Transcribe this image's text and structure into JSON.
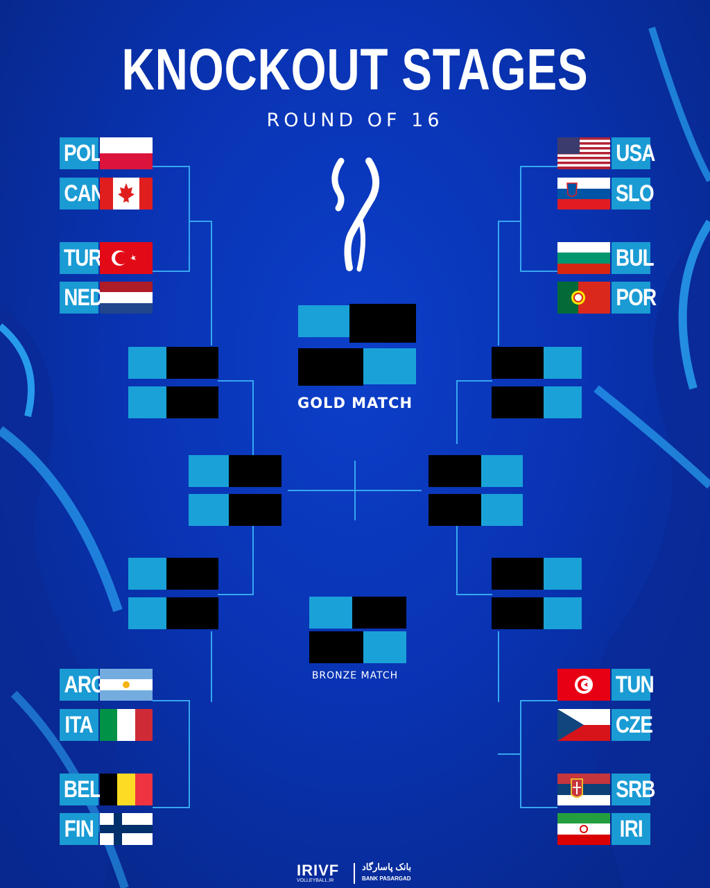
{
  "header": {
    "title": "KNOCKOUT STAGES",
    "subtitle": "ROUND OF 16"
  },
  "teams_left": [
    {
      "code": "POL",
      "flag": "poland-flag"
    },
    {
      "code": "CAN",
      "flag": "canada-flag"
    },
    {
      "code": "TUR",
      "flag": "turkey-flag"
    },
    {
      "code": "NED",
      "flag": "netherlands-flag"
    },
    {
      "code": "ARG",
      "flag": "argentina-flag"
    },
    {
      "code": "ITA",
      "flag": "italy-flag"
    },
    {
      "code": "BEL",
      "flag": "belgium-flag"
    },
    {
      "code": "FIN",
      "flag": "finland-flag"
    }
  ],
  "teams_right": [
    {
      "code": "USA",
      "flag": "usa-flag"
    },
    {
      "code": "SLO",
      "flag": "slovenia-flag"
    },
    {
      "code": "BUL",
      "flag": "bulgaria-flag"
    },
    {
      "code": "POR",
      "flag": "portugal-flag"
    },
    {
      "code": "TUN",
      "flag": "tunisia-flag"
    },
    {
      "code": "CZE",
      "flag": "czechia-flag"
    },
    {
      "code": "SRB",
      "flag": "serbia-flag"
    },
    {
      "code": "IRI",
      "flag": "iran-flag"
    }
  ],
  "matches": {
    "gold_label": "GOLD MATCH",
    "bronze_label": "BRONZE MATCH"
  },
  "footer": {
    "irvf": "IRIVF",
    "irvf_sub": "VOLLEYBALL.IR",
    "bank": "بانک پاسارگاد",
    "bank_sub": "BANK PASARGAD"
  },
  "colors": {
    "background": "#0933b3",
    "team_code_box": "#1a9bd4",
    "bracket_line": "#37a7f0",
    "placeholder_dark": "#000000"
  }
}
